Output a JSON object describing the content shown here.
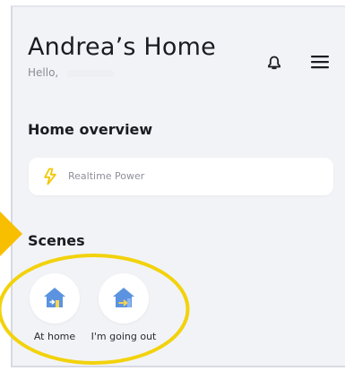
{
  "header": {
    "title": "Andrea’s Home",
    "greeting": "Hello,"
  },
  "icons": {
    "bell": "bell-icon",
    "menu": "menu-icon",
    "power": "lightning-icon",
    "home": "home-icon",
    "going_out": "home-exit-icon"
  },
  "overview": {
    "title": "Home overview",
    "card_label": "Realtime Power"
  },
  "scenes": {
    "title": "Scenes",
    "items": [
      {
        "label": "At home"
      },
      {
        "label": "I'm going out"
      }
    ]
  },
  "colors": {
    "accent_yellow": "#f5c400",
    "home_blue": "#5b93e0",
    "background": "#f2f3f7"
  }
}
